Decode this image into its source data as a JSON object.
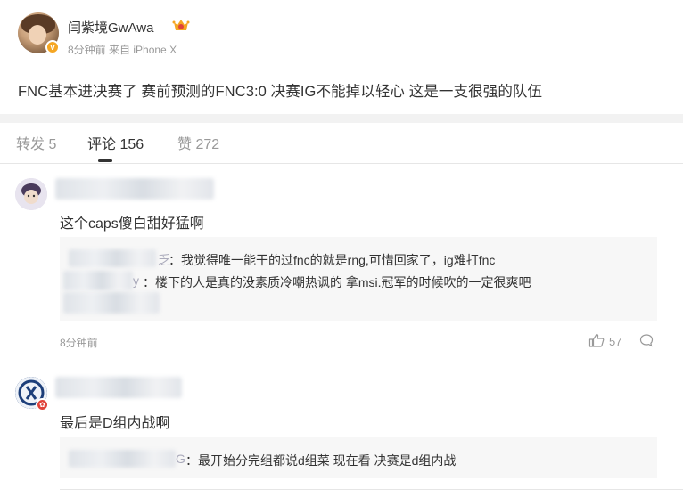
{
  "post": {
    "username": "闫紫境GwAwa",
    "verified_mark": "v",
    "time": "8分钟前",
    "source": "来自 iPhone X",
    "text": "FNC基本进决赛了 赛前预测的FNC3:0 决赛IG不能掉以轻心 这是一支很强的队伍"
  },
  "tabs": [
    {
      "label": "转发 5"
    },
    {
      "label": "评论 156"
    },
    {
      "label": "赞 272"
    }
  ],
  "comments": [
    {
      "text": "这个caps傻白甜好猛啊",
      "replies": [
        {
          "name_tail": "乏",
          "text": "：我觉得唯一能干的过fnc的就是rng,可惜回家了，ig难打fnc"
        },
        {
          "name_tail": "y",
          "text": "：楼下的人是真的没素质冷嘲热讽的 拿msi.冠军的时候吹的一定很爽吧"
        }
      ],
      "time": "8分钟前",
      "likes": "57"
    },
    {
      "text": "最后是D组内战啊",
      "replies": [
        {
          "name_tail": "G",
          "text": "：最开始分完组都说d组菜 现在看 决赛是d组内战"
        }
      ]
    }
  ],
  "colors": {
    "muted": "#999999",
    "text": "#333333",
    "verify": "#f5a623",
    "reply_bg": "#f7f7f7"
  }
}
